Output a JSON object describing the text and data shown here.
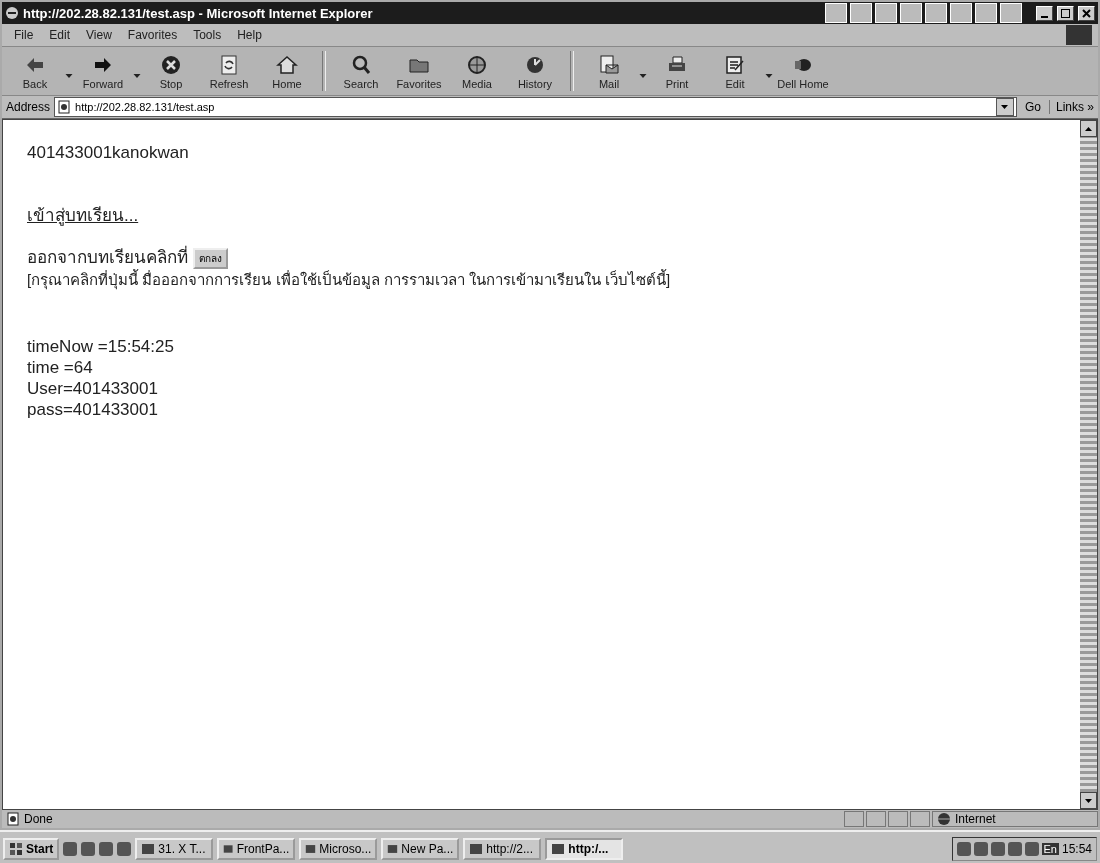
{
  "window": {
    "title": "http://202.28.82.131/test.asp - Microsoft Internet Explorer"
  },
  "menu": [
    "File",
    "Edit",
    "View",
    "Favorites",
    "Tools",
    "Help"
  ],
  "toolbar": [
    {
      "label": "Back",
      "kind": "back",
      "dropdown": true
    },
    {
      "label": "Forward",
      "kind": "forward",
      "dropdown": true
    },
    {
      "label": "Stop",
      "kind": "stop",
      "dropdown": false
    },
    {
      "label": "Refresh",
      "kind": "refresh",
      "dropdown": false
    },
    {
      "label": "Home",
      "kind": "home",
      "dropdown": false,
      "sep": true
    },
    {
      "label": "Search",
      "kind": "search",
      "dropdown": false
    },
    {
      "label": "Favorites",
      "kind": "favorites",
      "dropdown": false
    },
    {
      "label": "Media",
      "kind": "media",
      "dropdown": false
    },
    {
      "label": "History",
      "kind": "history",
      "dropdown": false,
      "sep": true
    },
    {
      "label": "Mail",
      "kind": "mail",
      "dropdown": true
    },
    {
      "label": "Print",
      "kind": "print",
      "dropdown": false
    },
    {
      "label": "Edit",
      "kind": "edit",
      "dropdown": true
    },
    {
      "label": "Dell Home",
      "kind": "dell",
      "dropdown": false
    }
  ],
  "address": {
    "label": "Address",
    "value": "http://202.28.82.131/test.asp",
    "go": "Go",
    "links": "Links »"
  },
  "content": {
    "heading": "401433001kanokwan",
    "link": "เข้าสู่บทเรียน...",
    "exit_label": "ออกจากบทเรียนคลิกที่",
    "exit_button": "ตกลง",
    "note": "[กรุณาคลิกที่ปุ่มนี้ มื่อออกจากการเรียน เพื่อใช้เป็นข้อมูล การรามเวลา ในการเข้ามาเรียนใน เว็บไซต์นี้]",
    "lines": [
      "timeNow =15:54:25",
      "time =64",
      "User=401433001",
      "pass=401433001"
    ]
  },
  "status_bar": {
    "text": "Done",
    "zone": "Internet"
  },
  "taskbar": {
    "start": "Start",
    "tasks": [
      {
        "label": "31. X T...",
        "selected": false
      },
      {
        "label": "FrontPa...",
        "selected": false
      },
      {
        "label": "Microso...",
        "selected": false
      },
      {
        "label": "New Pa...",
        "selected": false
      },
      {
        "label": "http://2...",
        "selected": false
      },
      {
        "label": "http:/...",
        "selected": true
      }
    ],
    "language": "En",
    "clock": "15:54"
  }
}
